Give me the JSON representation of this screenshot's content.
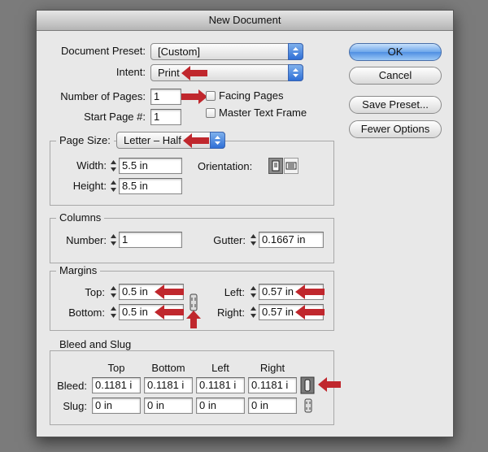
{
  "dialog": {
    "title": "New Document",
    "document_preset": {
      "label": "Document Preset:",
      "value": "[Custom]"
    },
    "intent": {
      "label": "Intent:",
      "value": "Print"
    },
    "number_of_pages": {
      "label": "Number of Pages:",
      "value": "1"
    },
    "start_page": {
      "label": "Start Page #:",
      "value": "1"
    },
    "facing_pages": {
      "label": "Facing Pages",
      "checked": false
    },
    "master_text_frame": {
      "label": "Master Text Frame",
      "checked": false
    },
    "buttons": {
      "ok": "OK",
      "cancel": "Cancel",
      "save_preset": "Save Preset...",
      "fewer_options": "Fewer Options"
    },
    "page_size": {
      "label": "Page Size:",
      "value": "Letter – Half",
      "width_label": "Width:",
      "width": "5.5 in",
      "height_label": "Height:",
      "height": "8.5 in",
      "orientation_label": "Orientation:",
      "orientation": "portrait"
    },
    "columns": {
      "title": "Columns",
      "number_label": "Number:",
      "number": "1",
      "gutter_label": "Gutter:",
      "gutter": "0.1667 in"
    },
    "margins": {
      "title": "Margins",
      "top_label": "Top:",
      "top": "0.5 in",
      "bottom_label": "Bottom:",
      "bottom": "0.5 in",
      "left_label": "Left:",
      "left": "0.57 in",
      "right_label": "Right:",
      "right": "0.57 in"
    },
    "bleed_slug": {
      "title": "Bleed and Slug",
      "col_top": "Top",
      "col_bottom": "Bottom",
      "col_left": "Left",
      "col_right": "Right",
      "bleed_label": "Bleed:",
      "bleed": [
        "0.1181 i",
        "0.1181 i",
        "0.1181 i",
        "0.1181 i"
      ],
      "slug_label": "Slug:",
      "slug": [
        "0 in",
        "0 in",
        "0 in",
        "0 in"
      ]
    }
  },
  "colors": {
    "annotation_arrow": "#c0272d",
    "default_button": "#5b9ae6",
    "select_arrows": "#3a7be0"
  },
  "icons": [
    "chevron-updown-icon",
    "spin-arrows-icon",
    "portrait-icon",
    "landscape-icon",
    "chain-link-icon",
    "annotation-arrow-icon"
  ]
}
